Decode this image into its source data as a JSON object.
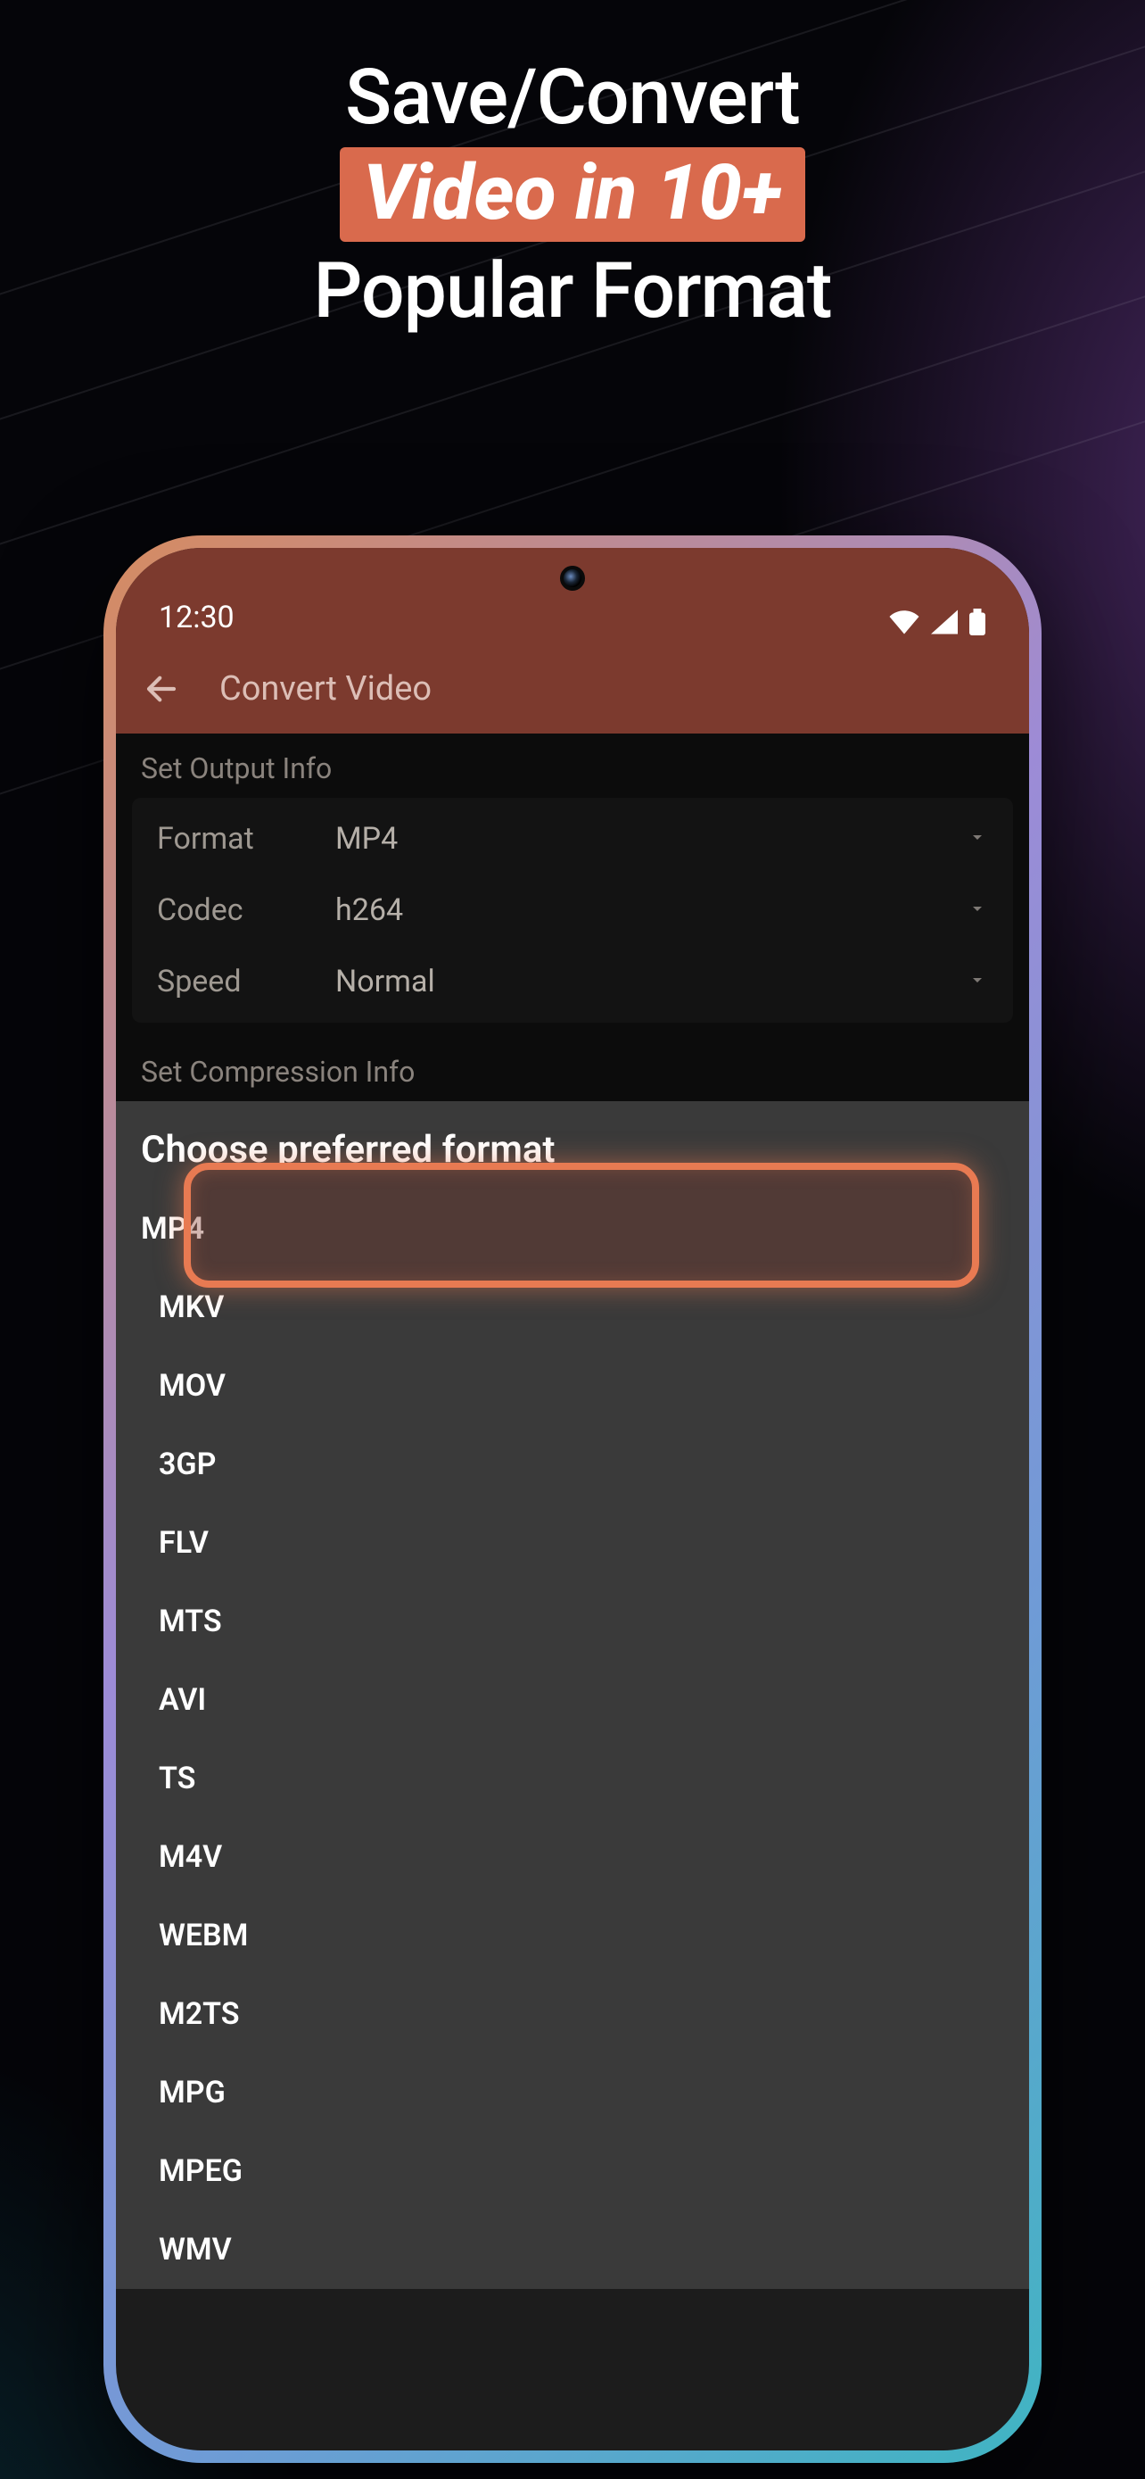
{
  "headline": {
    "line1": "Save/Convert",
    "pill": "Video in 10+",
    "line3": "Popular Format"
  },
  "status": {
    "time": "12:30"
  },
  "appbar": {
    "title": "Convert Video"
  },
  "sections": {
    "output_title": "Set Output Info",
    "compression_title": "Set Compression Info"
  },
  "output": {
    "format_label": "Format",
    "format_value": "MP4",
    "codec_label": "Codec",
    "codec_value": "h264",
    "speed_label": "Speed",
    "speed_value": "Normal"
  },
  "sheet": {
    "title": "Choose preferred format",
    "options": [
      "MP4",
      "MKV",
      "MOV",
      "3GP",
      "FLV",
      "MTS",
      "AVI",
      "TS",
      "M4V",
      "WEBM",
      "M2TS",
      "MPG",
      "MPEG",
      "WMV"
    ],
    "selected_index": 0
  }
}
